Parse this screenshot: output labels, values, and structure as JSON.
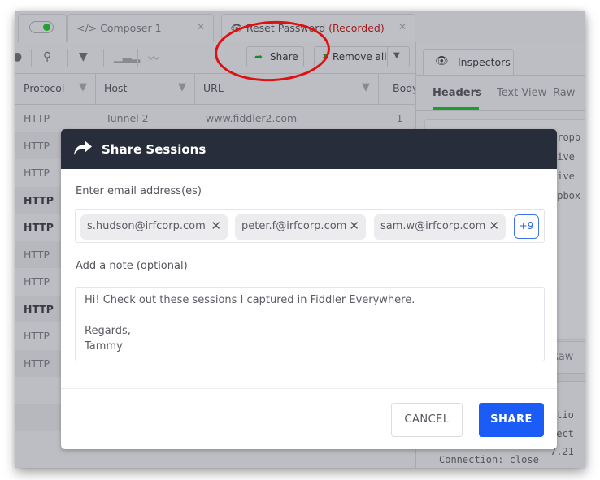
{
  "tabs": {
    "live_toggle": {
      "state": "on",
      "color": "#1fa32c"
    },
    "composer": {
      "icon": "code-icon",
      "label": "</> Composer 1",
      "close": "✕"
    },
    "session": {
      "icon": "eye-icon",
      "label": "Reset Password",
      "status": "(Recorded)",
      "close": "✕"
    }
  },
  "toolbar": {
    "icons": [
      "record-icon",
      "find-icon",
      "filter-icon",
      "stats-icon",
      "timeline-icon"
    ],
    "share_label": "Share",
    "remove_all_label": "Remove all"
  },
  "grid": {
    "columns": [
      {
        "label": "Protocol"
      },
      {
        "label": "Host"
      },
      {
        "label": "URL"
      },
      {
        "label": "Body"
      }
    ],
    "rows": [
      {
        "protocol": "HTTP",
        "host": "Tunnel 2",
        "url": "www.fiddler2.com",
        "body": "-1",
        "bold": false
      },
      {
        "protocol": "HTTP",
        "bold": false
      },
      {
        "protocol": "HTTP",
        "bold": false
      },
      {
        "protocol": "HTTP",
        "bold": true
      },
      {
        "protocol": "HTTP",
        "bold": true
      },
      {
        "protocol": "HTTP",
        "bold": false
      },
      {
        "protocol": "HTTP",
        "bold": false
      },
      {
        "protocol": "HTTP",
        "bold": true
      },
      {
        "protocol": "HTTP",
        "bold": false
      },
      {
        "protocol": "HTTP",
        "bold": false
      }
    ]
  },
  "inspectors": {
    "tab_label": "Inspectors",
    "subtabs": [
      "Headers",
      "Text View",
      "Raw"
    ],
    "active_subtab": "Headers",
    "code_lines": [
      "dropb",
      "live ",
      "live ",
      "opbox"
    ],
    "lower_raw_label": "Raw",
    "lower_code_lines": [
      "ctio",
      "rect",
      "7.21",
      "Connection: close"
    ]
  },
  "modal": {
    "title": "Share Sessions",
    "email_label": "Enter email address(es)",
    "emails": [
      "s.hudson@irfcorp.com",
      "peter.f@irfcorp.com",
      "sam.w@irfcorp.com"
    ],
    "more_count": "+9",
    "note_label": "Add a note (optional)",
    "note_lines": [
      "Hi! Check out these sessions I captured in Fiddler Everywhere.",
      "",
      "Regards,",
      "Tammy"
    ],
    "cancel_label": "CANCEL",
    "share_label": "SHARE",
    "share_color": "#1a5cf5"
  },
  "annotation": {
    "type": "ellipse",
    "color": "#e01010",
    "target": "share-toolbar-button"
  }
}
